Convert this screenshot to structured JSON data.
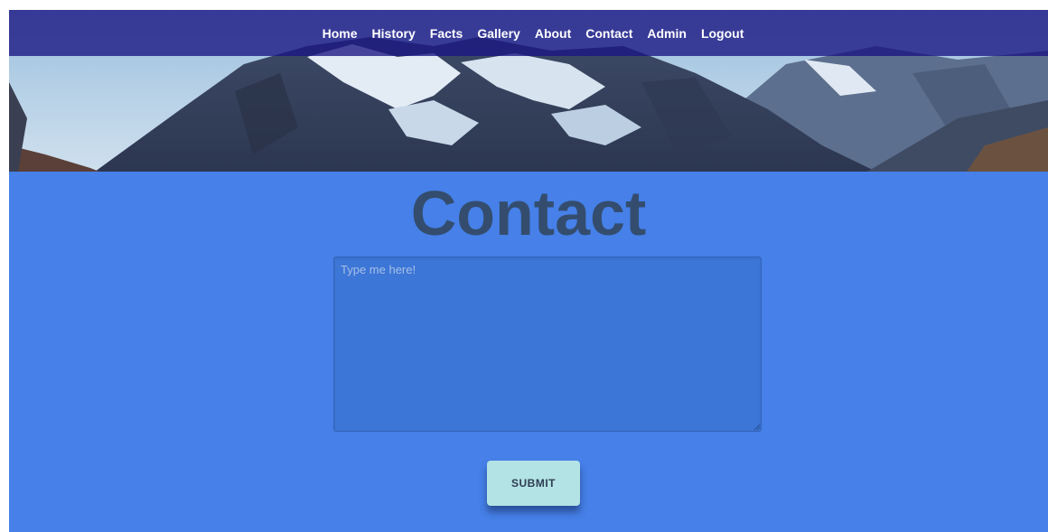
{
  "nav": {
    "items": [
      {
        "label": "Home"
      },
      {
        "label": "History"
      },
      {
        "label": "Facts"
      },
      {
        "label": "Gallery"
      },
      {
        "label": "About"
      },
      {
        "label": "Contact"
      },
      {
        "label": "Admin"
      },
      {
        "label": "Logout"
      }
    ]
  },
  "page": {
    "title": "Contact"
  },
  "form": {
    "message_placeholder": "Type me here!",
    "message_value": "",
    "submit_label": "SUBMIT"
  },
  "colors": {
    "nav_background": "#1b1683",
    "page_background": "#4680e8",
    "title": "#344d6e",
    "textarea_background": "#3c76d6",
    "submit_background": "#b3e3e4"
  }
}
